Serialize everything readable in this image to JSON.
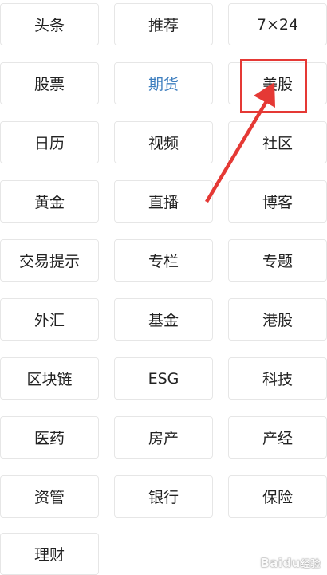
{
  "categories": [
    {
      "label": "头条"
    },
    {
      "label": "推荐"
    },
    {
      "label": "7×24"
    },
    {
      "label": "股票"
    },
    {
      "label": "期货"
    },
    {
      "label": "美股"
    },
    {
      "label": "日历"
    },
    {
      "label": "视频"
    },
    {
      "label": "社区"
    },
    {
      "label": "黄金"
    },
    {
      "label": "直播"
    },
    {
      "label": "博客"
    },
    {
      "label": "交易提示"
    },
    {
      "label": "专栏"
    },
    {
      "label": "专题"
    },
    {
      "label": "外汇"
    },
    {
      "label": "基金"
    },
    {
      "label": "港股"
    },
    {
      "label": "区块链"
    },
    {
      "label": "ESG"
    },
    {
      "label": "科技"
    },
    {
      "label": "医药"
    },
    {
      "label": "房产"
    },
    {
      "label": "产经"
    },
    {
      "label": "资管"
    },
    {
      "label": "银行"
    },
    {
      "label": "保险"
    },
    {
      "label": "理财"
    }
  ],
  "active_category": "期货",
  "annotation": {
    "highlighted": "美股",
    "color": "#e53935"
  },
  "colors": {
    "active_text": "#3f7fbf",
    "text": "#222222",
    "border": "#e6e6e6"
  },
  "watermark": {
    "text": "Baidu",
    "sub": "经验"
  }
}
